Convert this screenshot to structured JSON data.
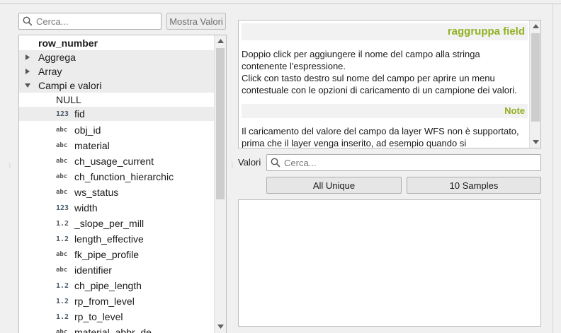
{
  "left": {
    "search_placeholder": "Cerca...",
    "show_values_label": "Mostra Valori",
    "tree": [
      {
        "label": "row_number",
        "kind": "item-bold",
        "indent": 0
      },
      {
        "label": "Aggrega",
        "kind": "group-collapsed"
      },
      {
        "label": "Array",
        "kind": "group-collapsed"
      },
      {
        "label": "Campi e valori",
        "kind": "group-expanded"
      },
      {
        "label": "NULL",
        "kind": "child"
      },
      {
        "label": "fid",
        "kind": "field",
        "type": "123",
        "selected": true
      },
      {
        "label": "obj_id",
        "kind": "field",
        "type": "abc"
      },
      {
        "label": "material",
        "kind": "field",
        "type": "abc"
      },
      {
        "label": "ch_usage_current",
        "kind": "field",
        "type": "abc"
      },
      {
        "label": "ch_function_hierarchic",
        "kind": "field",
        "type": "abc"
      },
      {
        "label": "ws_status",
        "kind": "field",
        "type": "abc"
      },
      {
        "label": "width",
        "kind": "field",
        "type": "123"
      },
      {
        "label": "_slope_per_mill",
        "kind": "field",
        "type": "1.2"
      },
      {
        "label": "length_effective",
        "kind": "field",
        "type": "1.2"
      },
      {
        "label": "fk_pipe_profile",
        "kind": "field",
        "type": "abc"
      },
      {
        "label": "identifier",
        "kind": "field",
        "type": "abc"
      },
      {
        "label": "ch_pipe_length",
        "kind": "field",
        "type": "1.2"
      },
      {
        "label": "rp_from_level",
        "kind": "field",
        "type": "1.2"
      },
      {
        "label": "rp_to_level",
        "kind": "field",
        "type": "1.2"
      },
      {
        "label": "material_abbr_de",
        "kind": "field",
        "type": "abc"
      }
    ]
  },
  "help": {
    "title": "raggruppa field",
    "line1": "Doppio click per aggiungere il nome del campo alla stringa",
    "line2": "contenente l'espressione.",
    "line3": "Click con tasto destro sul nome del campo per aprire un menu",
    "line4": "contestuale con le opzioni di caricamento di un campione dei valori.",
    "note_title": "Note",
    "note_line1": "Il caricamento del valore del campo da layer WFS non è supportato,",
    "note_line2": "prima che il layer venga inserito, ad esempio quando si"
  },
  "values": {
    "label": "Valori",
    "search_placeholder": "Cerca...",
    "all_unique_label": "All Unique",
    "samples_label": "10 Samples"
  },
  "colors": {
    "accent_green": "#93b023",
    "selection_gray": "#ececec"
  }
}
